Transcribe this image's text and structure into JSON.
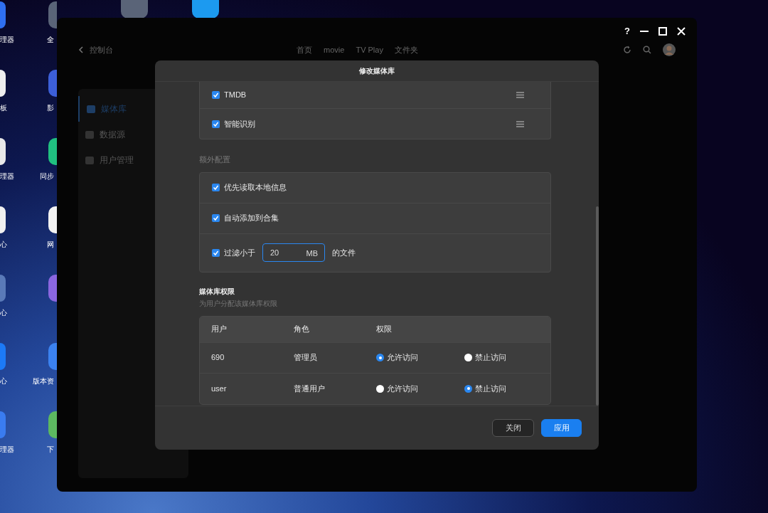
{
  "desktop_left_icons": [
    {
      "label": "理器"
    },
    {
      "label": "板"
    },
    {
      "label": "理器"
    },
    {
      "label": "心"
    },
    {
      "label": "心"
    },
    {
      "label": "心"
    },
    {
      "label": "理器"
    }
  ],
  "desktop_second_icons": [
    {
      "label": "全"
    },
    {
      "label": "影"
    },
    {
      "label": "同步"
    },
    {
      "label": "网"
    },
    {
      "label": "版本资"
    },
    {
      "label": "下"
    }
  ],
  "window": {
    "help": "?"
  },
  "app_header": {
    "back": "控制台",
    "nav": [
      "首页",
      "movie",
      "TV Play",
      "文件夹"
    ]
  },
  "sidebar": {
    "items": [
      {
        "label": "媒体库",
        "selected": true
      },
      {
        "label": "数据源",
        "selected": false
      },
      {
        "label": "用户管理",
        "selected": false
      }
    ]
  },
  "dialog": {
    "title": "修改媒体库",
    "sources": [
      {
        "label": "TMDB",
        "checked": true
      },
      {
        "label": "智能识别",
        "checked": true
      }
    ],
    "extra_title": "额外配置",
    "extra_options": [
      {
        "kind": "checkbox",
        "label": "优先读取本地信息",
        "checked": true
      },
      {
        "kind": "checkbox",
        "label": "自动添加到合集",
        "checked": true
      },
      {
        "kind": "size_filter",
        "label": "过滤小于",
        "value": "20",
        "unit": "MB",
        "suffix": "的文件",
        "checked": true
      }
    ],
    "permissions": {
      "title": "媒体库权限",
      "subtitle": "为用户分配该媒体库权限",
      "columns": [
        "用户",
        "角色",
        "权限"
      ],
      "rows": [
        {
          "user": "690",
          "role": "管理员",
          "options": [
            {
              "label": "允许访问",
              "selected": true
            },
            {
              "label": "禁止访问",
              "selected": false
            }
          ]
        },
        {
          "user": "user",
          "role": "普通用户",
          "options": [
            {
              "label": "允许访问",
              "selected": false
            },
            {
              "label": "禁止访问",
              "selected": true
            }
          ]
        }
      ]
    },
    "buttons": [
      {
        "kind": "secondary",
        "label": "关闭"
      },
      {
        "kind": "primary",
        "label": "应用"
      }
    ]
  }
}
